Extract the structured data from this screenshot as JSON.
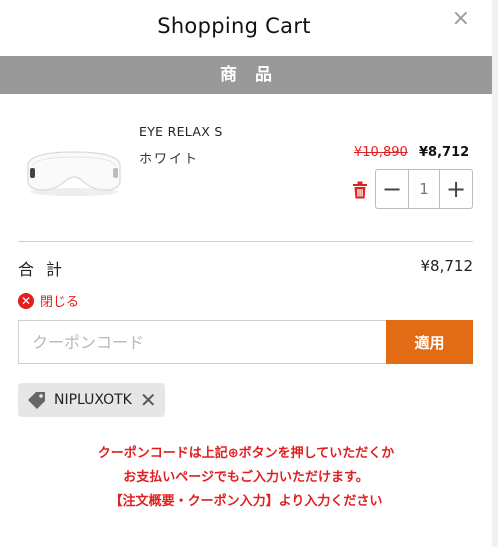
{
  "header": {
    "title": "Shopping Cart",
    "close_symbol": "×"
  },
  "section": {
    "label": "商品"
  },
  "item": {
    "name": "EYE RELAX S",
    "variant": "ホワイト",
    "price_original": "¥10,890",
    "price_sale": "¥8,712",
    "quantity": "1",
    "minus": "−",
    "plus": "+"
  },
  "total": {
    "label": "合計",
    "value": "¥8,712"
  },
  "coupon": {
    "close_label": "閉じる",
    "placeholder": "クーポンコード",
    "apply_label": "適用",
    "applied_code": "NIPLUXOTK",
    "remove_symbol": "✕"
  },
  "notice": {
    "line1": "クーポンコードは上記⊕ボタンを押していただくか",
    "line2": "お支払いページでもご入力いただけます。",
    "line3": "【注文概要・クーポン入力】より入力ください"
  },
  "colors": {
    "accent": "#e26b16",
    "danger": "#e02020",
    "section_bar": "#999999"
  },
  "icons": [
    "close-icon",
    "trash-icon",
    "tag-icon",
    "x-circle-icon"
  ]
}
